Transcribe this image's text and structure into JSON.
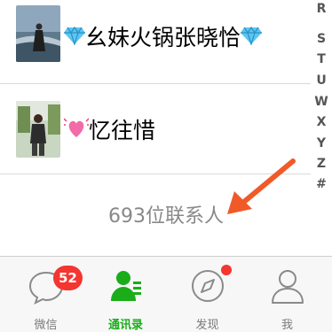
{
  "contacts": [
    {
      "name": "幺妹火锅张晓恰",
      "prefix_icon": "diamond-icon",
      "suffix_icon": "diamond-icon"
    },
    {
      "name": "忆往惜",
      "prefix_icon": "sparkling-heart-icon"
    }
  ],
  "contact_count": "693位联系人",
  "index_letters": [
    "R",
    "S",
    "T",
    "U",
    "W",
    "X",
    "Y",
    "Z",
    "#"
  ],
  "tabs": [
    {
      "label": "微信",
      "icon": "chat-bubble-icon",
      "badge": "52"
    },
    {
      "label": "通讯录",
      "icon": "contacts-icon",
      "active": true
    },
    {
      "label": "发现",
      "icon": "compass-icon",
      "dot": true
    },
    {
      "label": "我",
      "icon": "person-icon"
    }
  ],
  "colors": {
    "accent": "#1aad19",
    "badge": "#f43530",
    "muted": "#888888",
    "annotation_arrow": "#f05a28"
  }
}
